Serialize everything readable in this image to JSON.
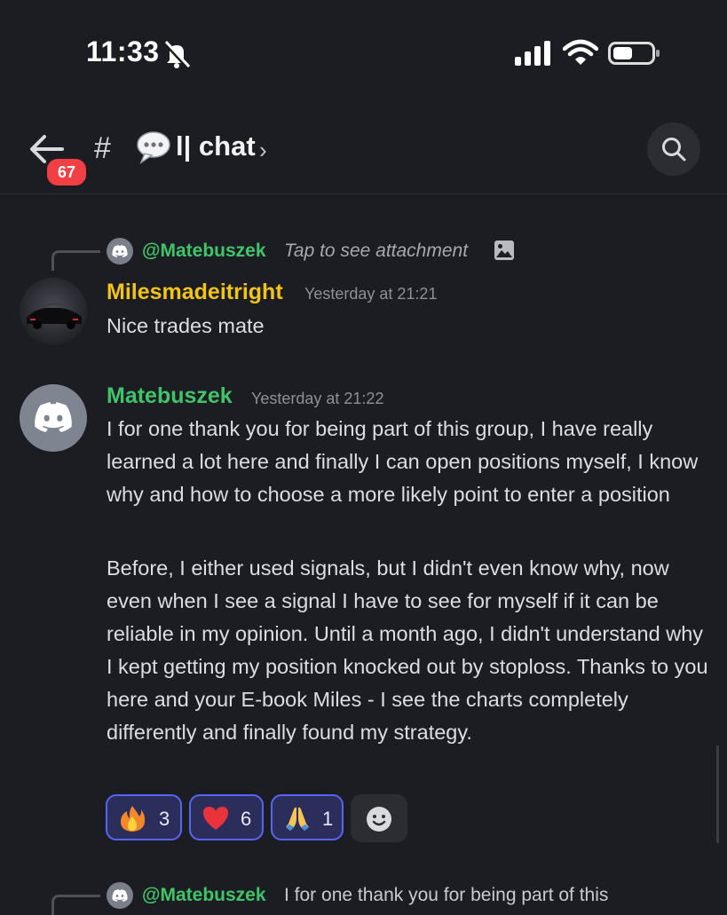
{
  "status_bar": {
    "time": "11:33",
    "icons": [
      "bell-slash-icon",
      "signal-icon",
      "wifi-icon",
      "battery-icon"
    ]
  },
  "header": {
    "back_icon": "arrow-left-icon",
    "unread_badge": "67",
    "channel_hash": "#",
    "channel_emoji": "speech-balloon-icon",
    "channel_name": "l| chat",
    "chevron": "›",
    "search_icon": "search-icon"
  },
  "messages": [
    {
      "reply": {
        "user": "@Matebuszek",
        "text": "Tap to see attachment",
        "icon": "image-icon"
      },
      "author": "Milesmadeitright",
      "author_color": "#f0c419",
      "timestamp": "Yesterday at 21:21",
      "paragraphs": [
        "Nice trades mate"
      ]
    },
    {
      "author": "Matebuszek",
      "author_color": "#3fc46a",
      "timestamp": "Yesterday at 21:22",
      "paragraphs": [
        "I for one thank you for being part of this group, I have really learned a lot here and finally I can open positions myself, I know why and how to choose a more likely point to enter a position",
        "Before, I either used signals, but I didn't even know why, now even when I see a signal I have to see for myself if it can be reliable in my opinion. Until a month ago, I didn't understand why I kept getting my position knocked out by stoploss. Thanks to you here and your E-book Miles - I see the charts completely differently and finally found my strategy."
      ],
      "reactions": [
        {
          "emoji": "fire-icon",
          "count": "3"
        },
        {
          "emoji": "red-heart-icon",
          "count": "6"
        },
        {
          "emoji": "folded-hands-icon",
          "count": "1"
        }
      ],
      "add_reaction_icon": "smiley-add-icon"
    }
  ],
  "next_reply": {
    "user": "@Matebuszek",
    "text": "I for one thank you for being part of this"
  },
  "colors": {
    "background": "#1c1d22",
    "reaction_bg": "#2b2e5a",
    "reaction_border": "#5865f2",
    "badge": "#f23f43"
  }
}
